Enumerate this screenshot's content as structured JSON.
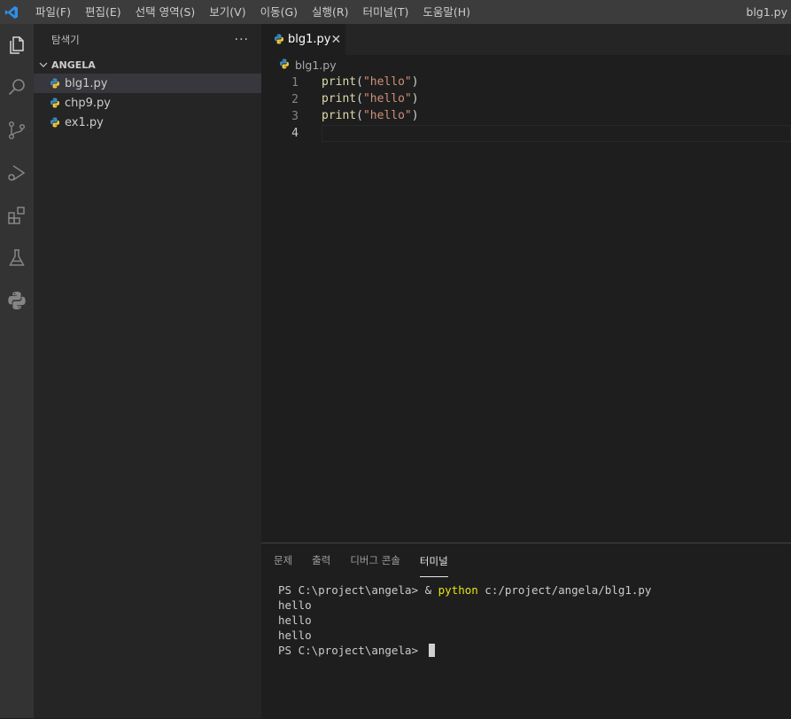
{
  "titlebar": {
    "menu": [
      "파일(F)",
      "편집(E)",
      "선택 영역(S)",
      "보기(V)",
      "이동(G)",
      "실행(R)",
      "터미널(T)",
      "도움말(H)"
    ],
    "window_title": "blg1.py"
  },
  "activity_icons": [
    "explorer-icon",
    "search-icon",
    "source-control-icon",
    "run-debug-icon",
    "extensions-icon",
    "testing-icon",
    "python-icon"
  ],
  "sidebar": {
    "title": "탐색기",
    "more": "···",
    "folder": "ANGELA",
    "files": [
      {
        "name": "blg1.py",
        "active": true
      },
      {
        "name": "chp9.py",
        "active": false
      },
      {
        "name": "ex1.py",
        "active": false
      }
    ]
  },
  "editor": {
    "tab": {
      "label": "blg1.py",
      "close": "✕"
    },
    "breadcrumb": "blg1.py",
    "lines": [
      {
        "num": "1",
        "fn": "print",
        "open": "(",
        "str": "\"hello\"",
        "close": ")"
      },
      {
        "num": "2",
        "fn": "print",
        "open": "(",
        "str": "\"hello\"",
        "close": ")"
      },
      {
        "num": "3",
        "fn": "print",
        "open": "(",
        "str": "\"hello\"",
        "close": ")"
      },
      {
        "num": "4",
        "fn": "",
        "open": "",
        "str": "",
        "close": ""
      }
    ],
    "current_line": 4
  },
  "panel": {
    "tabs": [
      "문제",
      "출력",
      "디버그 콘솔",
      "터미널"
    ],
    "active_tab": "터미널",
    "terminal": {
      "command_prompt": "PS C:\\project\\angela> & ",
      "command_exe": "python",
      "command_arg": " c:/project/angela/blg1.py",
      "output": [
        "hello",
        "hello",
        "hello"
      ],
      "final_prompt": "PS C:\\project\\angela> "
    }
  },
  "colors": {
    "python_blue": "#3b8cc7",
    "python_yellow": "#f0c93a",
    "vscode_blue": "#2f8fe8"
  }
}
